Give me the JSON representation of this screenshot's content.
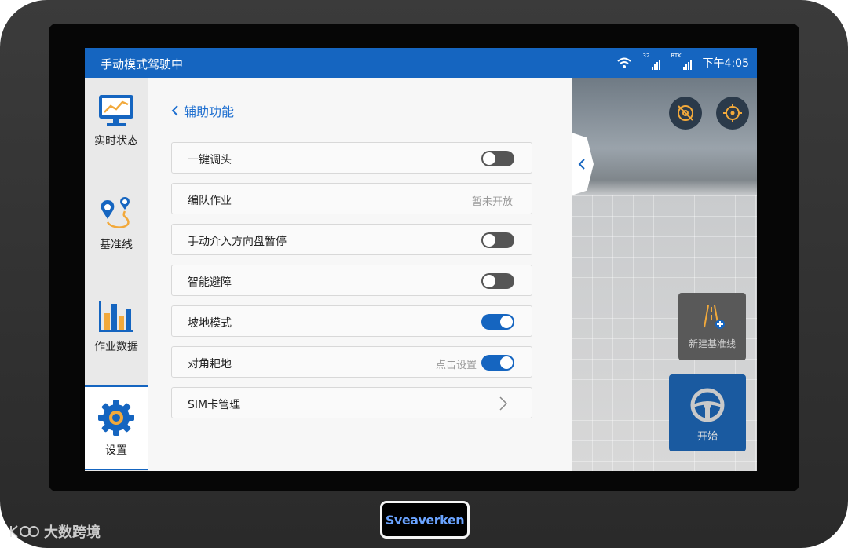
{
  "status_bar": {
    "title": "手动模式驾驶中",
    "gps_count": "32",
    "rtk_label": "RTK",
    "time": "下午4:05"
  },
  "sidebar": {
    "items": [
      {
        "label": "实时状态",
        "icon": "monitor-chart-icon"
      },
      {
        "label": "基准线",
        "icon": "map-pin-route-icon"
      },
      {
        "label": "作业数据",
        "icon": "bar-chart-icon"
      },
      {
        "label": "设置",
        "icon": "gear-icon"
      }
    ],
    "active_index": 3
  },
  "panel": {
    "back_label": "辅助功能",
    "rows": [
      {
        "label": "一键调头",
        "control": "toggle",
        "on": false
      },
      {
        "label": "编队作业",
        "control": "text",
        "hint": "暂未开放"
      },
      {
        "label": "手动介入方向盘暂停",
        "control": "toggle",
        "on": false
      },
      {
        "label": "智能避障",
        "control": "toggle",
        "on": false
      },
      {
        "label": "坡地模式",
        "control": "toggle",
        "on": true
      },
      {
        "label": "对角耙地",
        "control": "toggle",
        "on": true,
        "hint": "点击设置"
      },
      {
        "label": "SIM卡管理",
        "control": "chevron"
      }
    ]
  },
  "map": {
    "new_line_label": "新建基准线",
    "start_label": "开始"
  },
  "device": {
    "brand": "Sveaverken",
    "watermark": "大数跨境"
  },
  "colors": {
    "accent": "#1565c0",
    "toggle_off": "#555555",
    "orange": "#f2a93b"
  }
}
